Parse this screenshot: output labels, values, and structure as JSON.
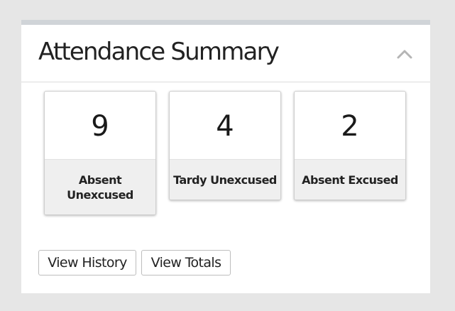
{
  "panel": {
    "title": "Attendance Summary",
    "collapse_icon": "chevron-up-icon"
  },
  "cards": [
    {
      "value": "9",
      "label": "Absent Unexcused"
    },
    {
      "value": "4",
      "label": "Tardy Unexcused"
    },
    {
      "value": "2",
      "label": "Absent Excused"
    }
  ],
  "buttons": {
    "view_history": "View History",
    "view_totals": "View Totals"
  },
  "colors": {
    "page_background": "#e6e6e6",
    "panel_background": "#ffffff",
    "panel_top_border": "#d0d4d8",
    "card_label_background": "#efefef",
    "chevron": "#b5b5b5"
  }
}
